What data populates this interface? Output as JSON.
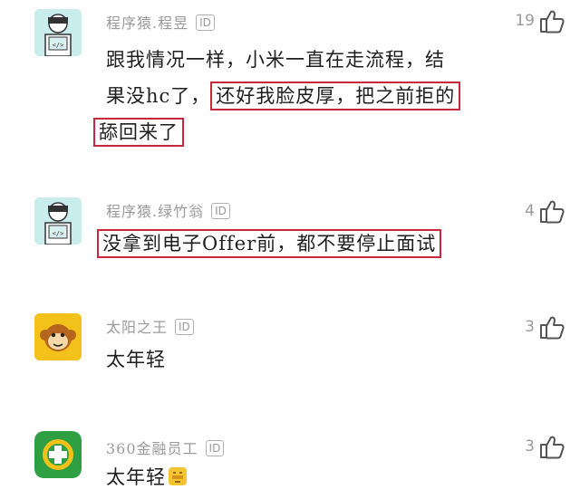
{
  "comments": [
    {
      "user": "程序猿.程昱",
      "id_badge": "ID",
      "likes": "19",
      "avatar_icon": "programmer-avatar-icon",
      "text_line1": "跟我情况一样，小米一直在走流程，结",
      "text_line2_plain": "果没hc了，",
      "text_line2_highlight": "还好我脸皮厚，把之前拒的",
      "text_line3_highlight": "舔回来了"
    },
    {
      "user": "程序猿.绿竹翁",
      "id_badge": "ID",
      "likes": "4",
      "avatar_icon": "programmer-avatar-icon",
      "text_highlight": "没拿到电子Offer前，都不要停止面试"
    },
    {
      "user": "太阳之王",
      "id_badge": "ID",
      "likes": "3",
      "avatar_icon": "monkey-avatar-icon",
      "text": "太年轻"
    },
    {
      "user": "360金融员工",
      "id_badge": "ID",
      "likes": "3",
      "avatar_icon": "360-logo-avatar-icon",
      "text": "太年轻",
      "emoji": "facepalm-emoji-icon"
    }
  ],
  "colors": {
    "highlight_border": "#c8283c",
    "username": "#9a9a9a",
    "avatar_programmer_bg": "#c9ecec"
  }
}
